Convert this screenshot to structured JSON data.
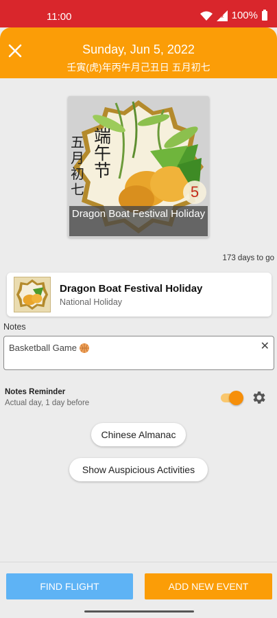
{
  "status_bar": {
    "time": "11:00",
    "battery": "100%",
    "icons": [
      "wifi-icon",
      "signal-icon",
      "battery-icon"
    ]
  },
  "header": {
    "title": "Sunday, Jun 5, 2022",
    "subtitle": "壬寅(虎)年丙午月己丑日 五月初七",
    "close_icon": "close-icon",
    "color": "#fb9d07"
  },
  "festival_image": {
    "title_chinese": "端午节",
    "lunar_vertical": "五月初七",
    "day_number": "5",
    "caption": "Dragon Boat Festival Holiday"
  },
  "countdown": "173 days to go",
  "event": {
    "name": "Dragon Boat Festival Holiday",
    "type": "National Holiday"
  },
  "notes": {
    "label": "Notes",
    "value": "Basketball Game",
    "emoji_icon": "basketball-icon",
    "clear_icon": "clear-icon"
  },
  "reminder": {
    "title": "Notes Reminder",
    "subtitle": "Actual day, 1 day before",
    "enabled": true,
    "settings_icon": "gear-icon"
  },
  "buttons": {
    "almanac": "Chinese Almanac",
    "auspicious": "Show Auspicious Activities",
    "find_flight": "FIND FLIGHT",
    "add_event": "ADD NEW EVENT"
  },
  "colors": {
    "status_bar": "#d9262c",
    "accent_orange": "#fb9d07",
    "flight_blue": "#5eb3f5"
  }
}
